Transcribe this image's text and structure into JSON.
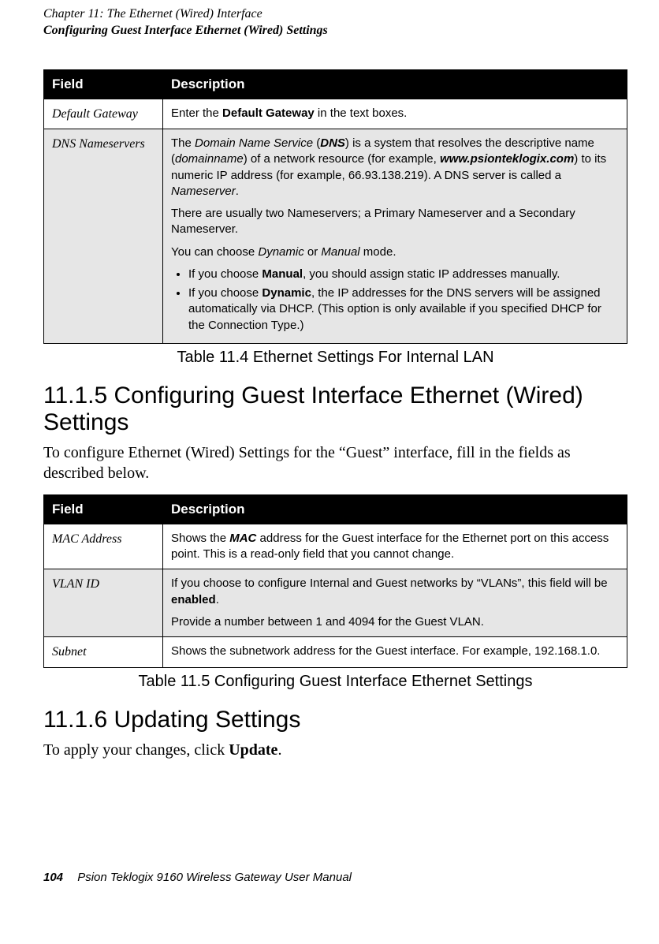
{
  "header": {
    "chapter_line": "Chapter 11:  The Ethernet (Wired) Interface",
    "section_line": "Configuring Guest Interface Ethernet (Wired) Settings"
  },
  "table1": {
    "col_field": "Field",
    "col_desc": "Description",
    "rows": [
      {
        "field": "Default Gateway",
        "desc_parts": {
          "p1a": "Enter the ",
          "p1b": "Default Gateway",
          "p1c": " in the text boxes."
        }
      },
      {
        "field": "DNS Nameservers",
        "desc_parts": {
          "p1a": "The ",
          "p1b": "Domain Name Service",
          "p1c": " (",
          "p1d": "DNS",
          "p1e": ") is a system that resolves the descriptive name (",
          "p1f": "domainname",
          "p1g": ") of a network resource (for example, ",
          "p1h": "www.psionteklogix.com",
          "p1i": ") to its numeric IP address (for example, 66.93.138.219). A DNS server is called a ",
          "p1j": "Nameserver",
          "p1k": ".",
          "p2": "There are usually two Nameservers; a Primary Nameserver and a Secondary Nameserver.",
          "p3a": "You can choose ",
          "p3b": "Dynamic",
          "p3c": " or ",
          "p3d": "Manual",
          "p3e": " mode.",
          "b1a": "If you choose ",
          "b1b": "Manual",
          "b1c": ", you should assign static IP addresses manually.",
          "b2a": "If you choose ",
          "b2b": "Dynamic",
          "b2c": ", the IP addresses for the DNS servers will be assigned automatically via DHCP. (This option is only available if you specified DHCP for the Connection Type.)"
        }
      }
    ],
    "caption": "Table 11.4 Ethernet Settings For Internal LAN"
  },
  "section1": {
    "heading": "11.1.5  Configuring Guest Interface Ethernet (Wired) Settings",
    "body": "To configure Ethernet (Wired) Settings for the “Guest” interface, fill in the fields as described below."
  },
  "table2": {
    "col_field": "Field",
    "col_desc": "Description",
    "rows": [
      {
        "field": "MAC Address",
        "desc_parts": {
          "a": "Shows the ",
          "b": "MAC",
          "c": " address for the Guest interface for the Ethernet port on this access point. This is a read-only field that you cannot change."
        }
      },
      {
        "field": "VLAN ID",
        "desc_parts": {
          "p1a": "If you choose to configure Internal and Guest networks by “VLANs”, this field will be ",
          "p1b": "enabled",
          "p1c": ".",
          "p2": "Provide a number between 1 and 4094 for the Guest VLAN."
        }
      },
      {
        "field": "Subnet",
        "desc_parts": {
          "a": "Shows the subnetwork address for the Guest interface. For example, 192.168.1.0."
        }
      }
    ],
    "caption": "Table 11.5 Configuring Guest Interface Ethernet Settings"
  },
  "section2": {
    "heading": "11.1.6  Updating Settings",
    "body_a": "To apply your changes, click ",
    "body_b": "Update",
    "body_c": "."
  },
  "footer": {
    "page": "104",
    "title": "Psion Teklogix 9160 Wireless Gateway User Manual"
  }
}
